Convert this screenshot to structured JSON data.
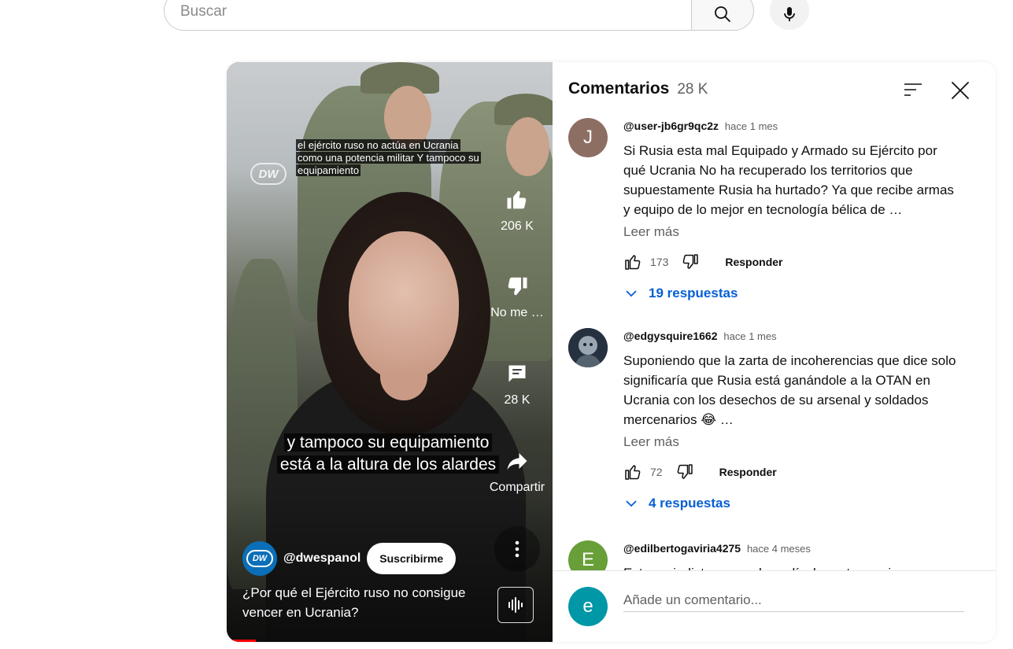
{
  "search": {
    "placeholder": "Buscar"
  },
  "video": {
    "caption_top_lines": [
      "el ejército ruso no actúa en Ucrania",
      "como una potencia militar Y tampoco su",
      "equipamiento"
    ],
    "watermark": "DW",
    "caption_main_lines": [
      "y tampoco su equipamiento",
      "está a la altura de los alardes"
    ],
    "actions": {
      "like_count": "206 K",
      "dislike_label": "No me …",
      "comments_count": "28 K",
      "share_label": "Compartir"
    },
    "channel": {
      "avatar_text": "DW",
      "name": "@dwespanol",
      "subscribe_label": "Suscribirme"
    },
    "title": "¿Por qué el Ejército ruso no consigue vencer en Ucrania?",
    "progress_fraction": 0.09
  },
  "comments_panel": {
    "title": "Comentarios",
    "count": "28 K",
    "items": [
      {
        "avatar_letter": "J",
        "avatar_color": "#8d6e63",
        "author": "@user-jb6gr9qc2z",
        "time": "hace 1 mes",
        "text": "Si Rusia esta mal Equipado y Armado su Ejército por qué Ucrania No ha recuperado los territorios que supuestamente Rusia ha hurtado? Ya que recibe armas y equipo de lo mejor en tecnología bélica de …",
        "read_more": "Leer más",
        "likes": "173",
        "reply_label": "Responder",
        "replies": "19 respuestas"
      },
      {
        "avatar_letter": "",
        "avatar_color": "#2f3b4a",
        "author": "@edgysquire1662",
        "time": "hace 1 mes",
        "text": "Suponiendo que la zarta de incoherencias que dice solo significaría que Rusia está ganándole a la OTAN en Ucrania con los desechos de su arsenal y soldados mercenarios 😂 …",
        "read_more": "Leer más",
        "likes": "72",
        "reply_label": "Responder",
        "replies": "4 respuestas"
      },
      {
        "avatar_letter": "E",
        "avatar_color": "#689f38",
        "author": "@edilbertogaviria4275",
        "time": "hace 4 meses",
        "text": "Este periodista ve mucha película norteamericana"
      }
    ],
    "add_comment": {
      "avatar_letter": "e",
      "avatar_color": "#0097a7",
      "placeholder": "Añade un comentario..."
    }
  },
  "colors": {
    "link_blue": "#065fd4",
    "progress_red": "#ff0000",
    "dw_blue": "#0a6fb8"
  }
}
